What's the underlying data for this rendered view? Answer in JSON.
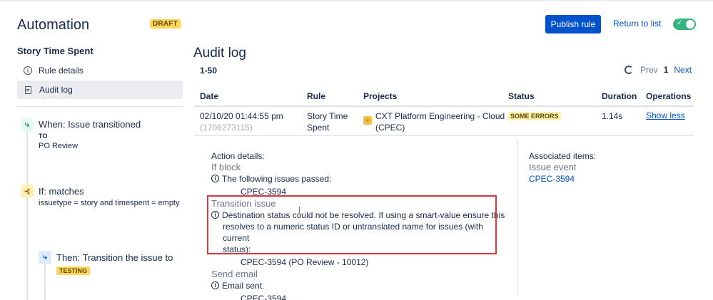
{
  "header": {
    "app_title": "Automation",
    "draft_label": "DRAFT",
    "publish_label": "Publish rule",
    "return_label": "Return to list",
    "toggle_check": "✓"
  },
  "sidebar": {
    "rule_name": "Story Time Spent",
    "nav": [
      {
        "label": "Rule details",
        "icon": "info-icon"
      },
      {
        "label": "Audit log",
        "icon": "document-icon"
      }
    ],
    "steps": {
      "when": {
        "title": "When: Issue transitioned",
        "to_label": "TO",
        "value": "PO Review"
      },
      "if": {
        "title": "If: matches",
        "condition": "issuetype = story and timespent = empty"
      },
      "then": {
        "title": "Then: Transition the issue to",
        "badge": "TESTING"
      }
    }
  },
  "main": {
    "title": "Audit log",
    "range": "1-50",
    "pager": {
      "prev": "Prev",
      "page": "1",
      "next": "Next"
    },
    "columns": [
      "Date",
      "Rule",
      "Projects",
      "Status",
      "Duration",
      "Operations"
    ],
    "row": {
      "date": "02/10/20 01:44:55 pm",
      "date_sub": "(1706273115)",
      "rule_line1": "Story Time",
      "rule_line2": "Spent",
      "project_line1": "CXT Platform Engineering - Cloud",
      "project_line2": "(CPEC)",
      "status": "SOME ERRORS",
      "duration": "1.14s",
      "operation": "Show less"
    },
    "details": {
      "heading": "Action details:",
      "if_block": "If block",
      "if_msg": "The following issues passed:",
      "if_issue": "CPEC-3594",
      "transition": "Transition issue",
      "transition_msg1": "Destination status could not be resolved. If using a smart-value ensure this",
      "transition_msg2": "resolves to a numeric status ID or untranslated name for issues (with current",
      "transition_msg3": "status):",
      "transition_issue": "CPEC-3594 (PO Review - 10012)",
      "email": "Send email",
      "email_msg": "Email sent.",
      "email_issue": "CPEC-3594"
    },
    "associated": {
      "heading": "Associated items:",
      "type": "Issue event",
      "issue": "CPEC-3594"
    }
  }
}
